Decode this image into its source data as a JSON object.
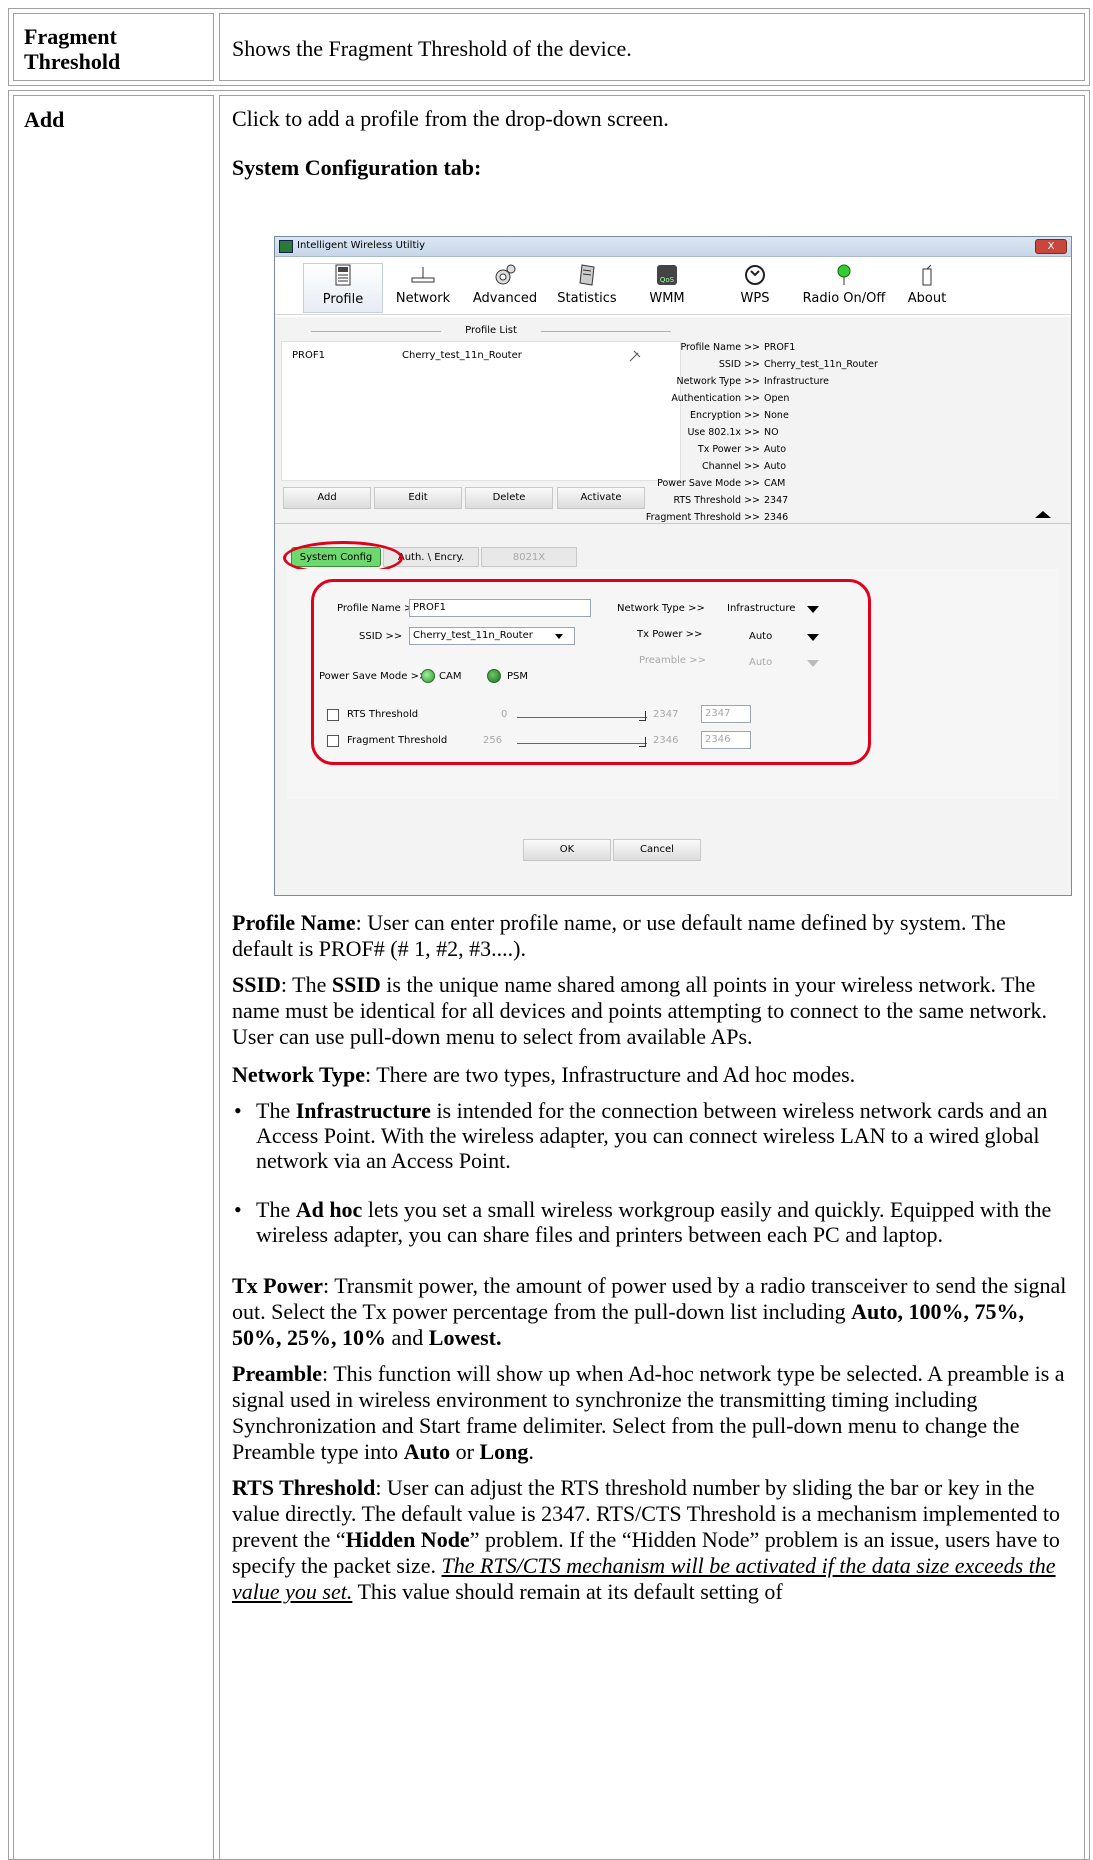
{
  "rows": [
    {
      "term": "Fragment Threshold",
      "desc": "Shows the Fragment Threshold of the device."
    },
    {
      "term": "Add",
      "intro": "Click to add a profile from the drop-down screen.",
      "section": "System Configuration tab:"
    }
  ],
  "window": {
    "title": "Intelligent Wireless Utiltiy",
    "close": "X",
    "toolbar": [
      "Profile",
      "Network",
      "Advanced",
      "Statistics",
      "WMM",
      "WPS",
      "Radio On/Off",
      "About"
    ],
    "wmm_badge": "QoS",
    "profile_list_title": "Profile List",
    "profile_row": {
      "name": "PROF1",
      "ssid": "Cherry_test_11n_Router"
    },
    "details": [
      {
        "k": "Profile Name >>",
        "v": "PROF1"
      },
      {
        "k": "SSID >>",
        "v": "Cherry_test_11n_Router"
      },
      {
        "k": "Network Type >>",
        "v": "Infrastructure"
      },
      {
        "k": "Authentication >>",
        "v": "Open"
      },
      {
        "k": "Encryption >>",
        "v": "None"
      },
      {
        "k": "Use 802.1x >>",
        "v": "NO"
      },
      {
        "k": "Tx Power >>",
        "v": "Auto"
      },
      {
        "k": "Channel >>",
        "v": "Auto"
      },
      {
        "k": "Power Save Mode >>",
        "v": "CAM"
      },
      {
        "k": "RTS Threshold >>",
        "v": "2347"
      },
      {
        "k": "Fragment Threshold >>",
        "v": "2346"
      }
    ],
    "buttons": [
      "Add",
      "Edit",
      "Delete",
      "Activate"
    ],
    "tabs": [
      "System Config",
      "Auth. \\ Encry.",
      "8021X"
    ],
    "form": {
      "profile_name_label": "Profile Name >>",
      "profile_name_value": "PROF1",
      "ssid_label": "SSID >>",
      "ssid_value": "Cherry_test_11n_Router",
      "network_type_label": "Network Type >>",
      "network_type_value": "Infrastructure",
      "tx_power_label": "Tx Power >>",
      "tx_power_value": "Auto",
      "preamble_label": "Preamble >>",
      "preamble_value": "Auto",
      "power_save_label": "Power Save Mode >>",
      "cam": "CAM",
      "psm": "PSM",
      "rts_label": "RTS Threshold",
      "rts_min": "0",
      "rts_max": "2347",
      "rts_value": "2347",
      "frag_label": "Fragment Threshold",
      "frag_min": "256",
      "frag_max": "2346",
      "frag_value": "2346"
    },
    "ok": "OK",
    "cancel": "Cancel"
  },
  "text": {
    "pn_b": "Profile Name",
    "pn": ": User can enter profile name, or use default name defined by system. The default is PROF# (# 1, #2, #3....).",
    "ssid_b": "SSID",
    "ssid_1": ": The ",
    "ssid_b2": "SSID",
    "ssid_2": " is the unique name shared among all points in your wireless network. The name must be identical for all devices and points attempting to connect to the same network. User can use pull-down menu to select from available APs.",
    "nt_b": "Network Type",
    "nt": ": There are two types, Infrastructure and Ad hoc modes.",
    "b1_a": "The ",
    "b1_b": "Infrastructure",
    "b1_c": " is intended for the connection between wireless network cards and an Access Point. With the wireless adapter, you can connect wireless LAN to a wired global network via an Access Point.",
    "b2_a": "The ",
    "b2_b": "Ad hoc",
    "b2_c": " lets you set a small wireless workgroup easily and quickly. Equipped with the wireless adapter, you can share files and printers between each PC and laptop.",
    "tx_b": "Tx Power",
    "tx": ": Transmit power, the amount of power used by a radio transceiver to send the signal out. Select the Tx power percentage from the pull-down list including ",
    "tx_list": "Auto, 100%, 75%, 50%, 25%, 10%",
    "tx_and": " and ",
    "tx_low": "Lowest.",
    "pre_b": "Preamble",
    "pre": ": This function will show up when Ad-hoc network type be selected. A preamble is a signal used in wireless environment to synchronize the transmitting timing including Synchronization and Start frame delimiter. Select from the pull-down menu to change the Preamble type into ",
    "pre_auto": "Auto",
    "pre_or": " or ",
    "pre_long": "Long",
    "pre_end": ".",
    "rts_b": "RTS Threshold",
    "rts_1": ": User can adjust the RTS threshold number by sliding the bar or key in the value directly. The default value is 2347. RTS/CTS Threshold is a mechanism implemented to prevent the “",
    "rts_hn": "Hidden Node",
    "rts_2": "” problem. If the “Hidden Node” problem is an issue, users have to specify the packet size. ",
    "rts_i": "The RTS/CTS mechanism will be activated if the data size exceeds the value you set.",
    "rts_3": " This value should remain at its default setting of"
  }
}
